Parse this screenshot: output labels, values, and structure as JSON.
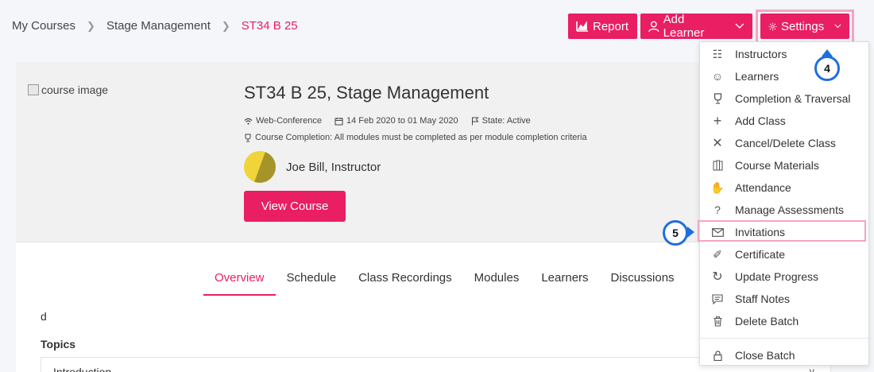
{
  "breadcrumb": {
    "items": [
      "My Courses",
      "Stage Management"
    ],
    "current": "ST34 B 25"
  },
  "toolbar": {
    "report_label": "Report",
    "add_learner_label": "Add Learner",
    "settings_label": "Settings"
  },
  "course": {
    "image_alt": "course image",
    "title": "ST34 B 25, Stage Management",
    "format": "Web-Conference",
    "dates": "14 Feb 2020 to 01 May 2020",
    "state": "State: Active",
    "completion": "Course Completion: All modules must be completed as per module completion criteria",
    "instructor": "Joe Bill, Instructor",
    "view_button": "View Course"
  },
  "tabs": [
    "Overview",
    "Schedule",
    "Class Recordings",
    "Modules",
    "Learners",
    "Discussions"
  ],
  "active_tab": "Overview",
  "content": {
    "description": "d",
    "topics_heading": "Topics",
    "first_topic": "Introduction"
  },
  "settings_menu": {
    "items": [
      {
        "label": "Instructors",
        "icon": "instructors-icon"
      },
      {
        "label": "Learners",
        "icon": "learners-icon"
      },
      {
        "label": "Completion & Traversal",
        "icon": "trophy-icon"
      },
      {
        "label": "Add Class",
        "icon": "plus-icon"
      },
      {
        "label": "Cancel/Delete Class",
        "icon": "x-icon"
      },
      {
        "label": "Course Materials",
        "icon": "books-icon"
      },
      {
        "label": "Attendance",
        "icon": "hand-icon"
      },
      {
        "label": "Manage Assessments",
        "icon": "question-icon"
      },
      {
        "label": "Invitations",
        "icon": "envelope-icon"
      },
      {
        "label": "Certificate",
        "icon": "certificate-icon"
      },
      {
        "label": "Update Progress",
        "icon": "refresh-icon"
      },
      {
        "label": "Staff Notes",
        "icon": "notes-icon"
      },
      {
        "label": "Delete Batch",
        "icon": "trash-icon"
      }
    ],
    "close_label": "Close Batch"
  },
  "callouts": {
    "settings": "4",
    "invitations": "5"
  },
  "colors": {
    "accent": "#e91e63",
    "highlight": "#f3a6c0",
    "callout": "#1e6fdc"
  }
}
